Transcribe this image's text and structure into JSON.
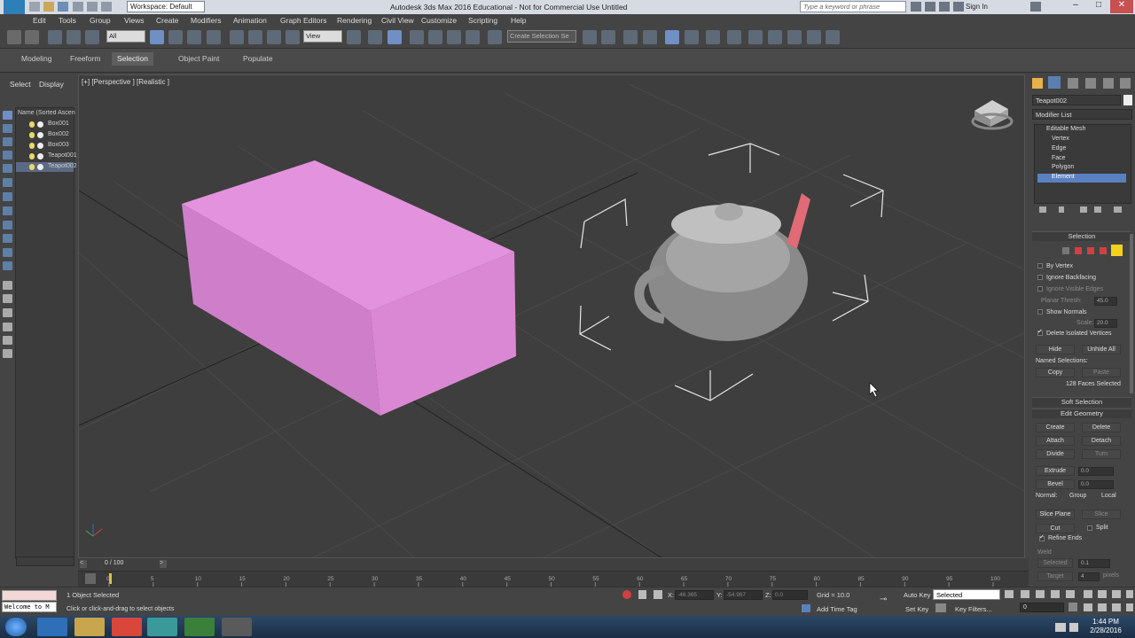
{
  "titlebar": {
    "workspace": "Workspace: Default",
    "title": "Autodesk 3ds Max 2016 Educational - Not for Commercial Use   Untitled",
    "search_placeholder": "Type a keyword or phrase",
    "sign_in": "Sign In"
  },
  "menubar": {
    "items": [
      "Edit",
      "Tools",
      "Group",
      "Views",
      "Create",
      "Modifiers",
      "Animation",
      "Graph Editors",
      "Rendering",
      "Civil View",
      "Customize",
      "Scripting",
      "Help"
    ]
  },
  "toolbar": {
    "selection_filter": "All",
    "ref_coord": "View",
    "named_selection": "Create Selection Se"
  },
  "ribbon": {
    "tabs": [
      "Modeling",
      "Freeform",
      "Selection",
      "Object Paint",
      "Populate"
    ],
    "active": "Selection"
  },
  "scene_explorer": {
    "tabs": [
      "Select",
      "Display"
    ],
    "header": "Name (Sorted Ascen",
    "items": [
      {
        "name": "Box001",
        "selected": false
      },
      {
        "name": "Box002",
        "selected": false
      },
      {
        "name": "Box003",
        "selected": false
      },
      {
        "name": "Teapot001",
        "selected": false
      },
      {
        "name": "Teapot002",
        "selected": true
      }
    ]
  },
  "viewport": {
    "label": "[+] [Perspective ] [Realistic ]"
  },
  "command_panel": {
    "object_name": "Teapot002",
    "modifier_list": "Modifier List",
    "stack": {
      "root": "Editable Mesh",
      "subobjects": [
        "Vertex",
        "Edge",
        "Face",
        "Polygon",
        "Element"
      ],
      "selected": "Element"
    },
    "selection": {
      "title": "Selection",
      "by_vertex": "By Vertex",
      "ignore_backfacing": "Ignore Backfacing",
      "ignore_visible_edges": "Ignore Visible Edges",
      "planar_thresh_label": "Planar Thresh:",
      "planar_thresh_value": "45.0",
      "show_normals": "Show Normals",
      "scale_label": "Scale:",
      "scale_value": "20.0",
      "delete_isolated": "Delete Isolated Vertices",
      "hide": "Hide",
      "unhide_all": "Unhide All",
      "named_selections": "Named Selections:",
      "copy": "Copy",
      "paste": "Paste",
      "status": "128 Faces Selected"
    },
    "soft_selection": "Soft Selection",
    "edit_geometry": {
      "title": "Edit Geometry",
      "create": "Create",
      "delete": "Delete",
      "attach": "Attach",
      "detach": "Detach",
      "divide": "Divide",
      "turn": "Turn",
      "extrude": "Extrude",
      "extrude_value": "0.0",
      "bevel": "Bevel",
      "bevel_value": "0.0",
      "normal_label": "Normal:",
      "group": "Group",
      "local": "Local",
      "slice_plane": "Slice Plane",
      "slice": "Slice",
      "cut": "Cut",
      "split": "Split",
      "refine_ends": "Refine Ends",
      "weld": "Weld",
      "selected": "Selected",
      "selected_value": "0.1",
      "target": "Target",
      "target_value": "4",
      "pixels": "pixels"
    }
  },
  "timeline": {
    "frame_label": "0 / 100",
    "ticks": [
      "0",
      "5",
      "10",
      "15",
      "20",
      "25",
      "30",
      "35",
      "40",
      "45",
      "50",
      "55",
      "60",
      "65",
      "70",
      "75",
      "80",
      "85",
      "90",
      "95",
      "100"
    ]
  },
  "status": {
    "maxscript": "Welcome to M",
    "selected": "1 Object Selected",
    "prompt": "Click or click-and-drag to select objects",
    "x_label": "X:",
    "x_value": "-46.365",
    "y_label": "Y:",
    "y_value": "-54.967",
    "z_label": "Z:",
    "z_value": "0.0",
    "grid": "Grid = 10.0",
    "add_time_tag": "Add Time Tag",
    "auto_key": "Auto Key",
    "set_key": "Set Key",
    "key_mode": "Selected",
    "key_filters": "Key Filters...",
    "frame": "0"
  },
  "taskbar": {
    "time": "1:44 PM",
    "date": "2/28/2016"
  },
  "colors": {
    "box": "#d685d0",
    "teapot": "#a9a9a9",
    "spout": "#e06a76",
    "stack_selected": "#5b80c0"
  }
}
